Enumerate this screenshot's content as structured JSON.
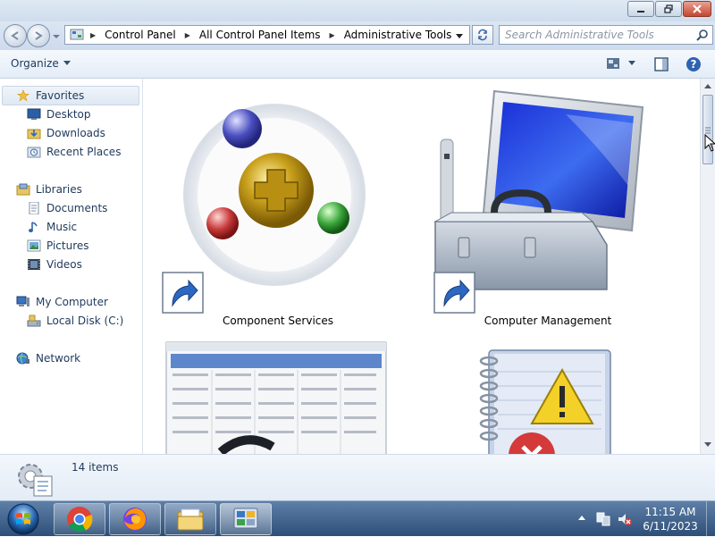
{
  "address": {
    "crumbs": [
      "Control Panel",
      "All Control Panel Items",
      "Administrative Tools"
    ]
  },
  "search": {
    "placeholder": "Search Administrative Tools"
  },
  "toolbar": {
    "organize_label": "Organize"
  },
  "sidebar": {
    "favorites": {
      "label": "Favorites",
      "items": [
        "Desktop",
        "Downloads",
        "Recent Places"
      ]
    },
    "libraries": {
      "label": "Libraries",
      "items": [
        "Documents",
        "Music",
        "Pictures",
        "Videos"
      ]
    },
    "computer": {
      "label": "My Computer",
      "items": [
        "Local Disk (C:)"
      ]
    },
    "network": {
      "label": "Network"
    }
  },
  "content": {
    "items": [
      {
        "label": "Component Services"
      },
      {
        "label": "Computer Management"
      }
    ]
  },
  "details": {
    "count_text": "14 items"
  },
  "taskbar": {
    "time": "11:15 AM",
    "date": "6/11/2023"
  },
  "colors": {
    "accent": "#1e395b",
    "titlebar": "#dfe9f5",
    "taskbar": "#2e4f78"
  }
}
